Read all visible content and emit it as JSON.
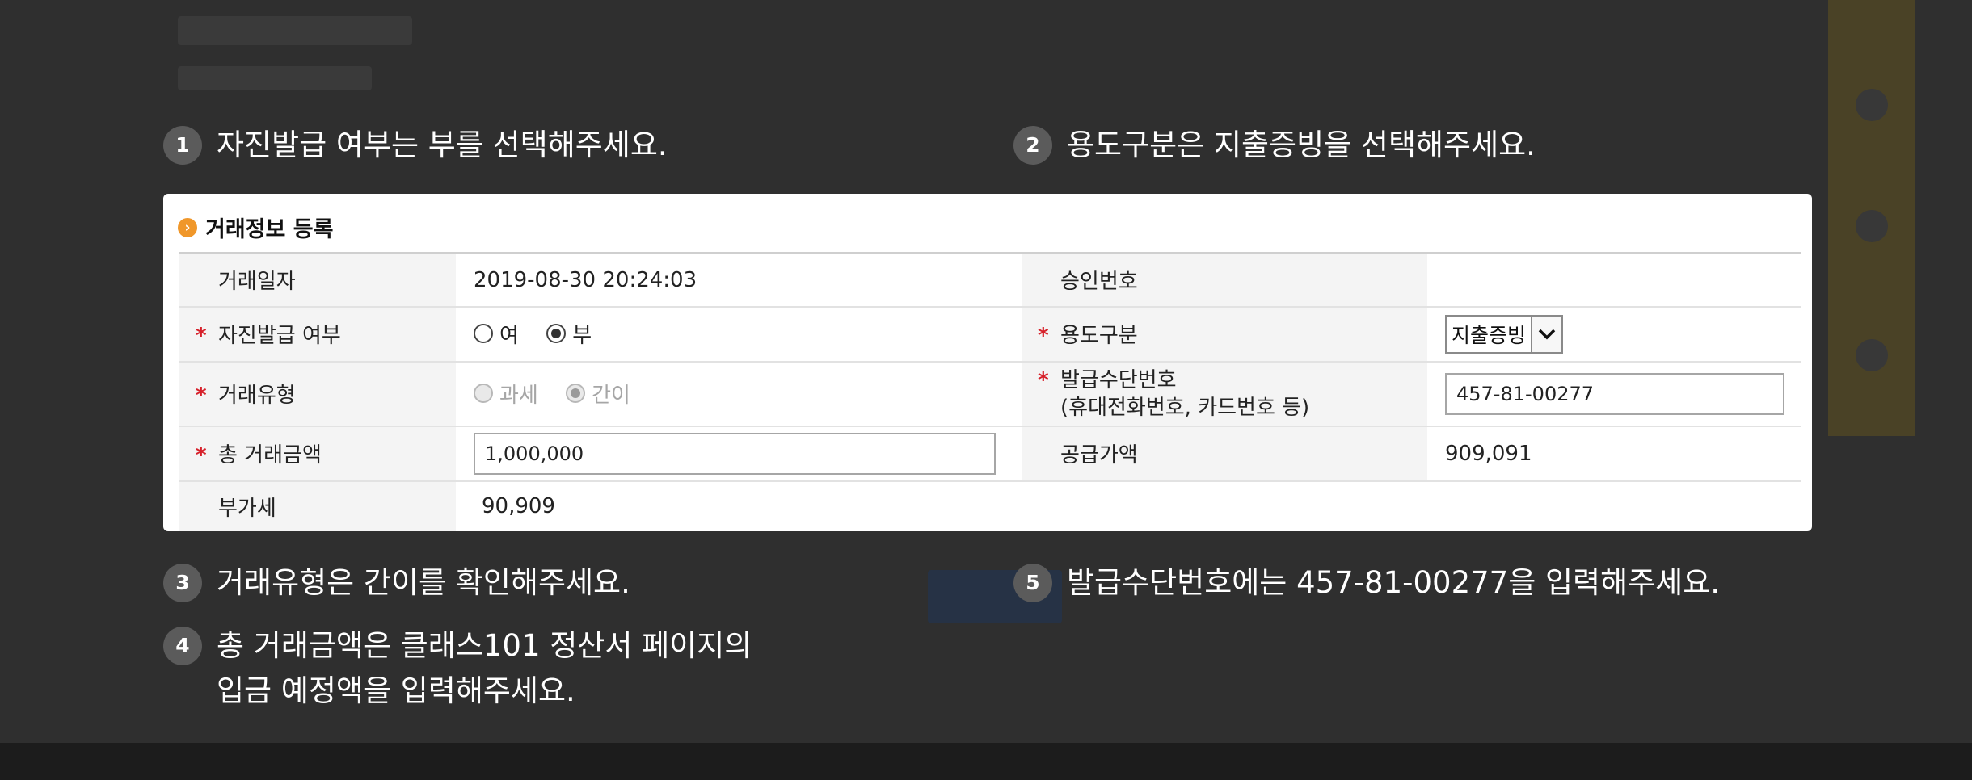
{
  "steps": [
    {
      "num": "1",
      "text": "자진발급 여부는 부를 선택해주세요."
    },
    {
      "num": "2",
      "text": "용도구분은 지출증빙을 선택해주세요."
    },
    {
      "num": "3",
      "text": "거래유형은 간이를 확인해주세요."
    },
    {
      "num": "4",
      "text": "총 거래금액은 클래스101 정산서 페이지의\n입금 예정액을 입력해주세요."
    },
    {
      "num": "5",
      "text": "발급수단번호에는 457-81-00277을 입력해주세요."
    }
  ],
  "form": {
    "title": "거래정보 등록",
    "required_mark": "*",
    "transaction_date_label": "거래일자",
    "transaction_date": "2019-08-30 20:24:03",
    "approval_no_label": "승인번호",
    "approval_no": "",
    "self_issue_label": "자진발급 여부",
    "self_issue_yes": "여",
    "self_issue_no": "부",
    "self_issue_selected": "부",
    "usage_label": "용도구분",
    "usage_value": "지출증빙",
    "trade_type_label": "거래유형",
    "trade_type_taxable": "과세",
    "trade_type_simple": "간이",
    "trade_type_selected": "간이",
    "issue_no_label": "발급수단번호",
    "issue_no_sub": "(휴대전화번호, 카드번호 등)",
    "issue_no_value": "457-81-00277",
    "total_label": "총 거래금액",
    "total_value": "1,000,000",
    "supply_label": "공급가액",
    "supply_value": "909,091",
    "vat_label": "부가세",
    "vat_value": "90,909"
  },
  "colors": {
    "overlay": "#2f2f2f",
    "required": "#d6202a",
    "title_bullet": "#f0972a"
  }
}
